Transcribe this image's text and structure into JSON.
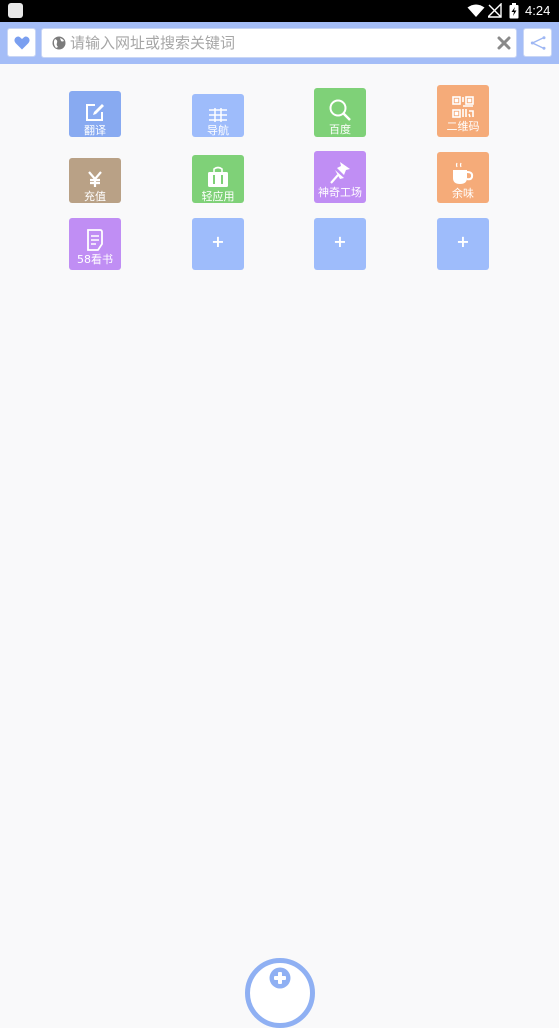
{
  "status_bar": {
    "time": "4:24",
    "icons": [
      "app-icon",
      "wifi-icon",
      "no-signal-icon",
      "battery-charging-icon"
    ]
  },
  "toolbar": {
    "favorite_icon": "heart-icon",
    "search": {
      "placeholder": "请输入网址或搜索关键词",
      "value": "",
      "leading_icon": "globe-icon",
      "clear_icon": "close-icon"
    },
    "share_icon": "share-icon"
  },
  "tiles": [
    {
      "label": "翻译",
      "icon": "edit-icon",
      "color": "#88aaf1"
    },
    {
      "label": "导航",
      "icon": "list-icon",
      "color": "#9ebcfb"
    },
    {
      "label": "百度",
      "icon": "search-icon",
      "color": "#7fd178"
    },
    {
      "label": "二维码",
      "icon": "qrcode-icon",
      "color": "#f5ab79"
    },
    {
      "label": "充值",
      "icon": "yen-icon",
      "color": "#b9a186"
    },
    {
      "label": "轻应用",
      "icon": "bag-icon",
      "color": "#7fd178"
    },
    {
      "label": "神奇工场",
      "icon": "pin-icon",
      "color": "#c08ef4"
    },
    {
      "label": "余味",
      "icon": "cup-icon",
      "color": "#f5ab79"
    },
    {
      "label": "58看书",
      "icon": "book-icon",
      "color": "#c08ef4"
    },
    {
      "label": "+",
      "icon": "add-icon",
      "color": "#9ebcfb"
    },
    {
      "label": "+",
      "icon": "add-icon",
      "color": "#9ebcfb"
    },
    {
      "label": "+",
      "icon": "add-icon",
      "color": "#9ebcfb"
    }
  ],
  "fab": {
    "icon": "add-circle-icon",
    "color": "#8fb0f3"
  }
}
